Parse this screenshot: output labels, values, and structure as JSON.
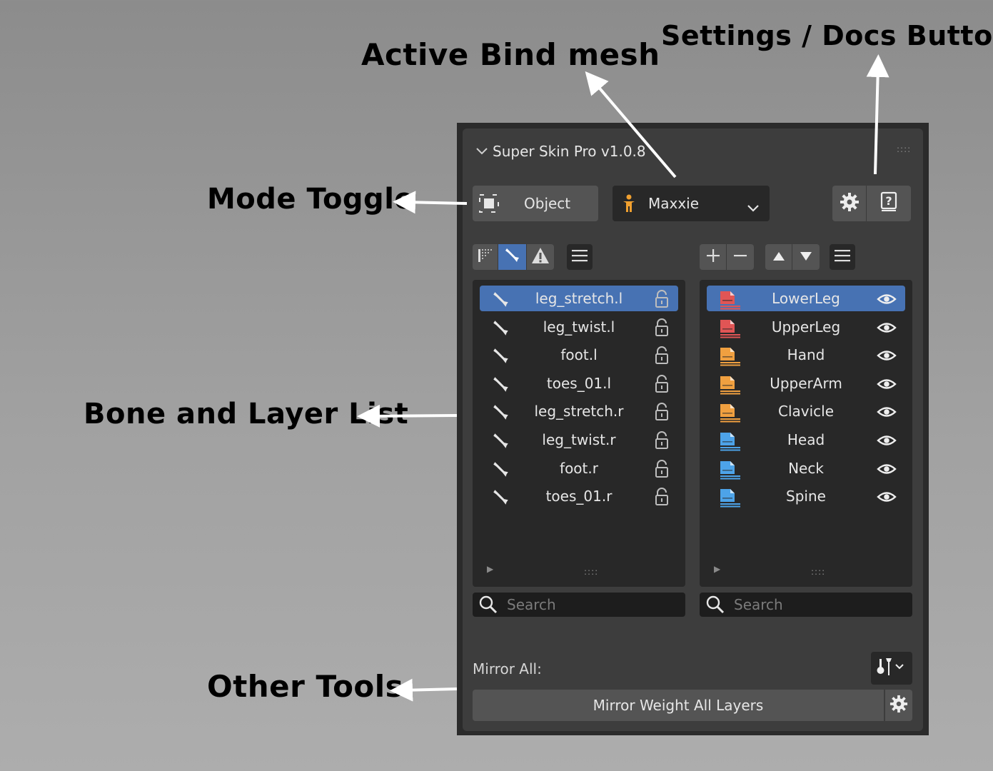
{
  "annotations": {
    "active_bind_mesh": "Active Bind mesh",
    "settings_docs": "Settings / Docs Button",
    "mode_toggle": "Mode Toggle",
    "bone_layer_list": "Bone and Layer List",
    "other_tools": "Other Tools"
  },
  "panel": {
    "title": "Super Skin Pro v1.0.8",
    "mode_label": "Object",
    "mesh_name": "Maxxie",
    "search_placeholder": "Search",
    "mirror_all_label": "Mirror All:",
    "mirror_weight_label": "Mirror Weight All Layers"
  },
  "bones": [
    {
      "name": "leg_stretch.l",
      "active": true
    },
    {
      "name": "leg_twist.l",
      "active": false
    },
    {
      "name": "foot.l",
      "active": false
    },
    {
      "name": "toes_01.l",
      "active": false
    },
    {
      "name": "leg_stretch.r",
      "active": false
    },
    {
      "name": "leg_twist.r",
      "active": false
    },
    {
      "name": "foot.r",
      "active": false
    },
    {
      "name": "toes_01.r",
      "active": false
    }
  ],
  "layers": [
    {
      "name": "LowerLeg",
      "color": "#e05555",
      "active": true
    },
    {
      "name": "UpperLeg",
      "color": "#e05555",
      "active": false
    },
    {
      "name": "Hand",
      "color": "#f0a040",
      "active": false
    },
    {
      "name": "UpperArm",
      "color": "#f0a040",
      "active": false
    },
    {
      "name": "Clavicle",
      "color": "#f0a040",
      "active": false
    },
    {
      "name": "Head",
      "color": "#4da3e8",
      "active": false
    },
    {
      "name": "Neck",
      "color": "#4da3e8",
      "active": false
    },
    {
      "name": "Spine",
      "color": "#4da3e8",
      "active": false
    }
  ],
  "icons": {
    "mode": "object-mode-icon",
    "mesh": "armature-person-icon",
    "settings": "gear-icon",
    "docs": "help-book-icon",
    "bone": "bone-icon",
    "lock": "unlock-icon",
    "eye": "eye-icon",
    "search": "search-icon"
  },
  "colors": {
    "accent": "#4772b3",
    "panel_bg": "#3d3d3d",
    "list_bg": "#282828",
    "mesh_icon": "#f0a030"
  }
}
